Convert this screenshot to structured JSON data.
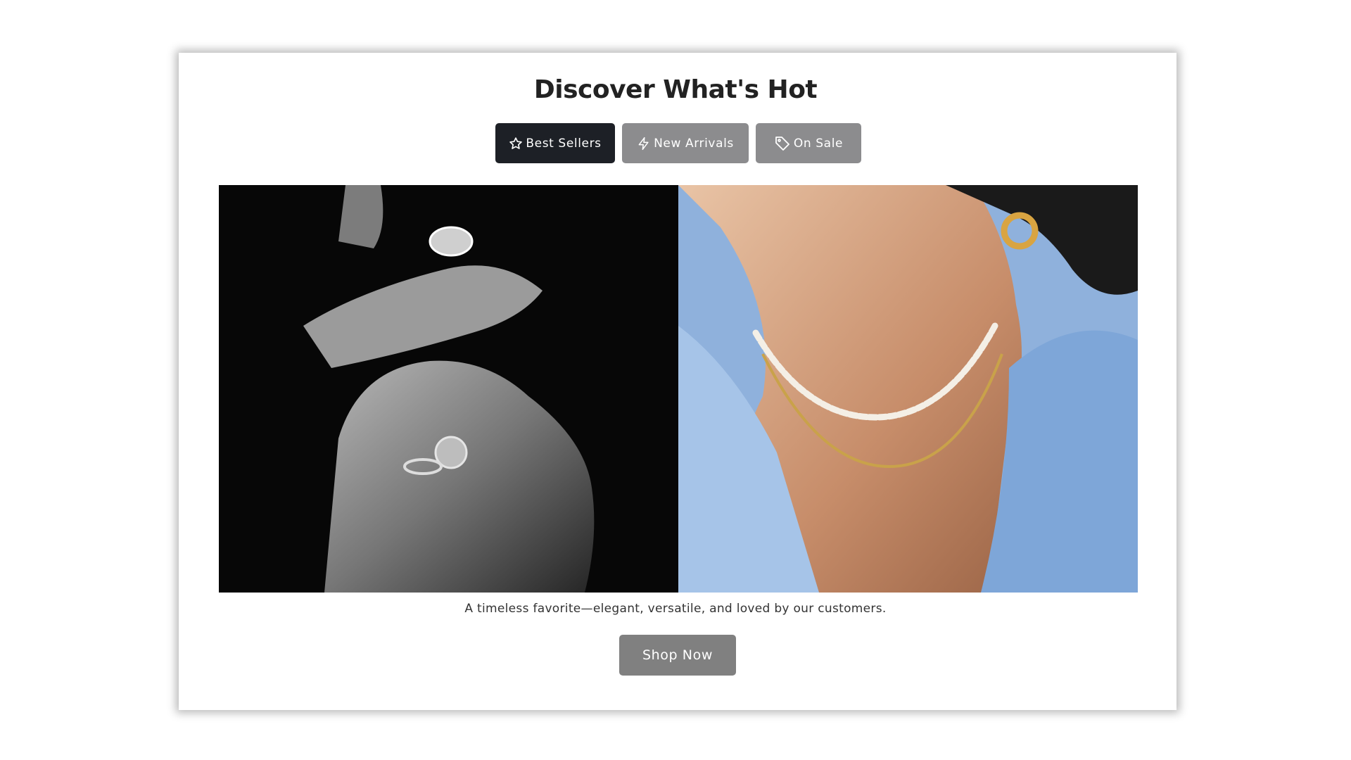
{
  "header": {
    "title": "Discover What's Hot"
  },
  "tabs": [
    {
      "label": "Best Sellers",
      "icon": "star-icon",
      "active": true
    },
    {
      "label": "New Arrivals",
      "icon": "lightning-icon",
      "active": false
    },
    {
      "label": "On Sale",
      "icon": "tag-icon",
      "active": false
    }
  ],
  "gallery": {
    "images": [
      {
        "subject": "hands-with-rings-photo",
        "tone": "black-and-white"
      },
      {
        "subject": "woman-wearing-necklaces-photo",
        "tone": "color"
      }
    ]
  },
  "caption": "A timeless favorite—elegant, versatile, and loved by our customers.",
  "cta": {
    "label": "Shop Now"
  },
  "colors": {
    "active_tab": "#1d2026",
    "inactive_tab": "#8c8c8e",
    "cta": "#808080",
    "title": "#222222"
  }
}
